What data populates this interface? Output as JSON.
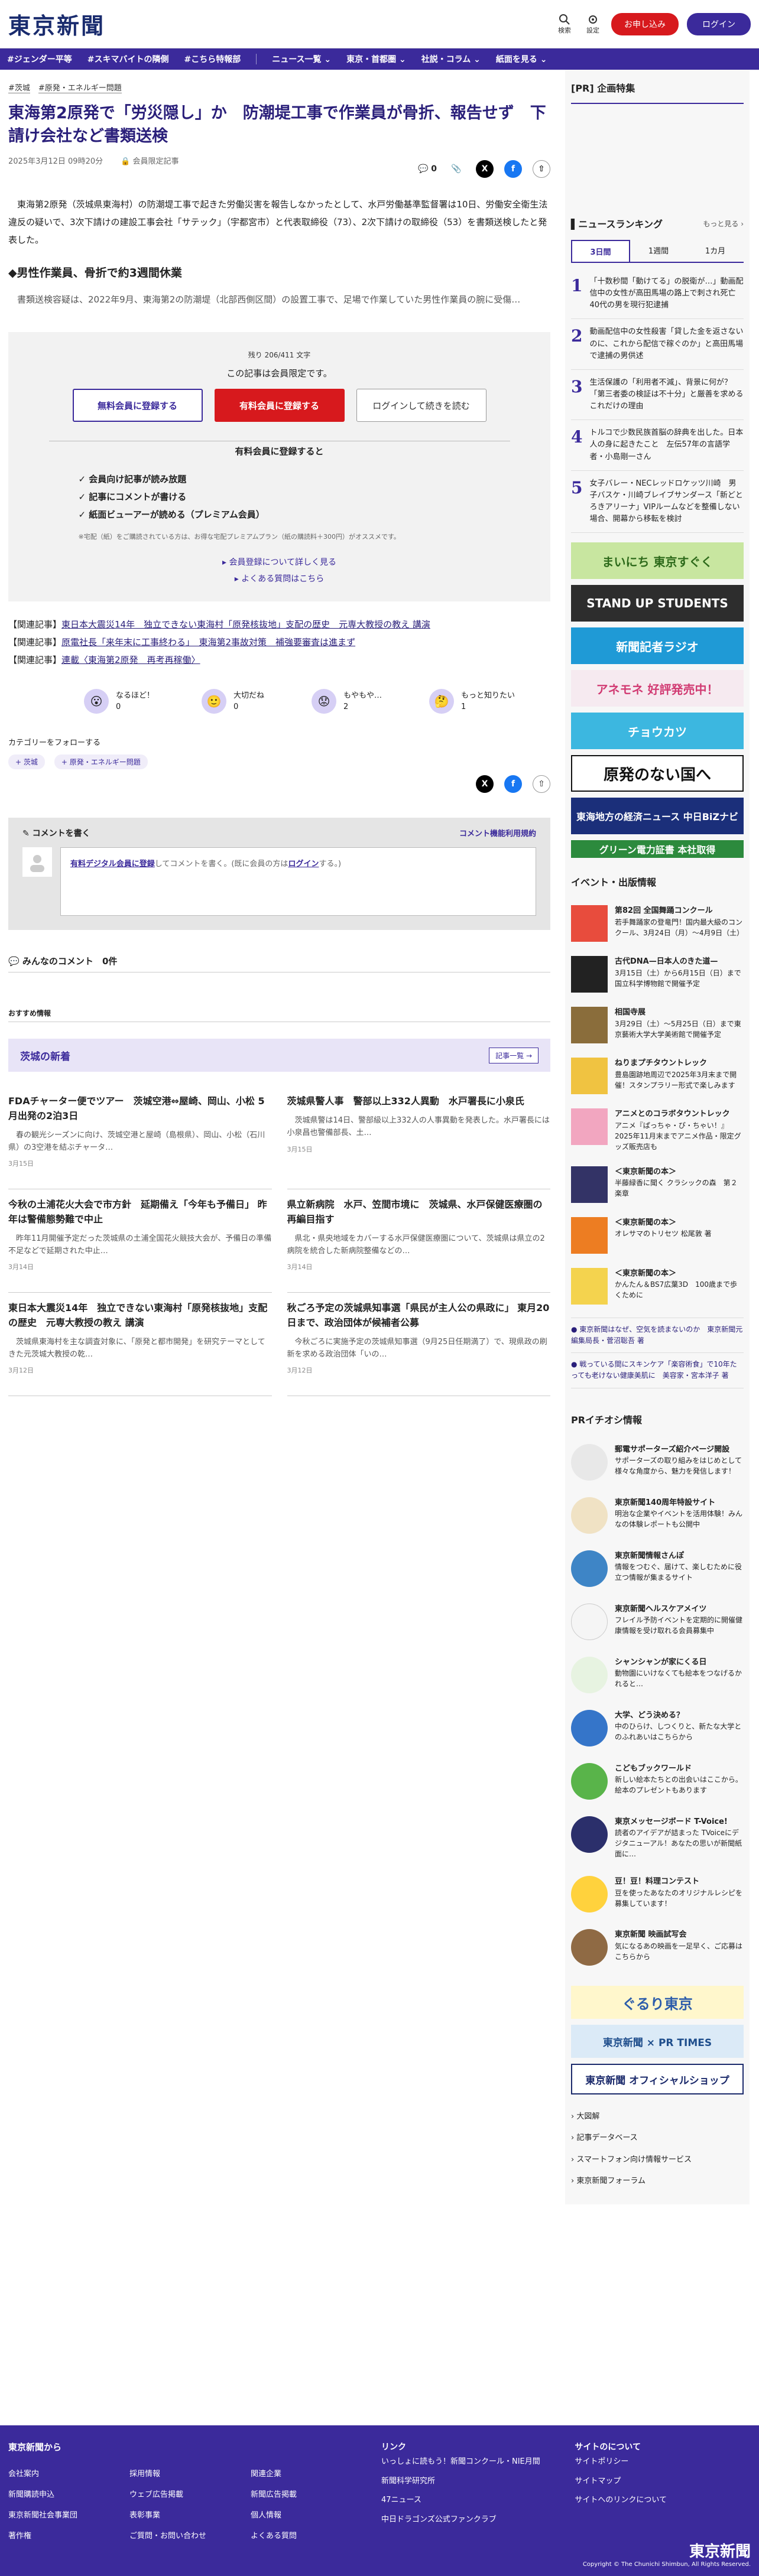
{
  "header": {
    "logo": "東京新聞",
    "search_label": "検索",
    "settings_label": "設定",
    "signup": "お申し込み",
    "login": "ログイン"
  },
  "nav": [
    "#ジェンダー平等",
    "#スキマバイトの隣側",
    "#こちら特報部",
    "ニュース一覧 ⌄",
    "東京・首都圏 ⌄",
    "社説・コラム ⌄",
    "紙面を見る ⌄"
  ],
  "article": {
    "tags": [
      "#茨城",
      "#原発・エネルギー問題"
    ],
    "title": "東海第2原発で「労災隠し」か　防潮堤工事で作業員が骨折、報告せず　下請け会社など書類送検",
    "date": "2025年3月12日 09時20分",
    "limited": "会員限定記事",
    "comment_count": "0",
    "lead": "　東海第2原発（茨城県東海村）の防潮堤工事で起きた労働災害を報告しなかったとして、水戸労働基準監督署は10日、労働安全衛生法違反の疑いで、3次下請けの建設工事会社「サテック」（宇都宮市）と代表取締役（73）、2次下請けの取締役（53）を書類送検したと発表した。",
    "subhead": "◆男性作業員、骨折で約3週間休業",
    "faded": "　書類送検容疑は、2022年9月、東海第2の防潮堤（北部西側区間）の設置工事で、足場で作業していた男性作業員の腕に受傷…"
  },
  "paywall": {
    "remaining": "残り 206/411 文字",
    "limited_text": "この記事は会員限定です。",
    "btn_free": "無料会員に登録する",
    "btn_paid": "有料会員に登録する",
    "btn_login": "ログインして続きを読む",
    "benefit_heading": "有料会員に登録すると",
    "benefits": [
      "✓ 会員向け記事が読み放題",
      "✓ 記事にコメントが書ける",
      "✓ 紙面ビューアーが読める（プレミアム会員）"
    ],
    "note": "※宅配（紙）をご購読されている方は、お得な宅配プレミアムプラン（紙の購読料＋300円）がオススメです。",
    "more1": "▸ 会員登録について詳しく見る",
    "more2": "▸ よくある質問はこちら"
  },
  "related": [
    {
      "prefix": "【関連記事】",
      "text": "東日本大震災14年　独立できない東海村「原発核抜地」支配の歴史　元専大教授の教え  講演"
    },
    {
      "prefix": "【関連記事】",
      "text": "原電社長「来年末に工事終わる」　東海第2事故対策　補強要審査は進まず"
    },
    {
      "prefix": "【関連記事】",
      "text": "連載〈東海第2原発　再考再稼働〉"
    }
  ],
  "reactions": [
    {
      "face": "😮",
      "label": "なるほど！",
      "count": "0"
    },
    {
      "face": "🙂",
      "label": "大切だね",
      "count": "0"
    },
    {
      "face": "😟",
      "label": "もやもや…",
      "count": "2"
    },
    {
      "face": "🤔",
      "label": "もっと知りたい",
      "count": "1"
    }
  ],
  "follow": {
    "label": "カテゴリーをフォローする",
    "chips": [
      "+ 茨城",
      "+ 原発・エネルギー問題"
    ]
  },
  "comment": {
    "title": "コメントを書く",
    "rules": "コメント機能利用規約",
    "link": "有料デジタル会員に登録",
    "text1": "してコメントを書く。(既に会員の方は",
    "login": "ログイン",
    "text2": "する。)",
    "all_label": "みんなのコメント",
    "all_count": "0件"
  },
  "recommend": {
    "label": "おすすめ情報",
    "section_title": "茨城の新着",
    "more": "記事一覧 →",
    "cards": [
      {
        "title": "FDAチャーター便でツアー　茨城空港⇔屋崎、岡山、小松 5月出発の2泊3日",
        "summary": "　春の観光シーズンに向け、茨城空港と屋崎（島根県）、岡山、小松（石川県）の3空港を結ぶチャータ…",
        "date": "3月15日"
      },
      {
        "title": "茨城県警人事　警部以上332人異動　水戸署長に小泉氏",
        "summary": "　茨城県警は14日、警部級以上332人の人事異動を発表した。水戸署長には小泉昌也警備部長、土…",
        "date": "3月15日"
      },
      {
        "title": "今秋の土浦花火大会で市方針　延期備え「今年も予備日」 昨年は警備態勢難で中止",
        "summary": "　昨年11月開催予定だった茨城県の土浦全国花火競技大会が、予備日の準備不足などで延期された中止…",
        "date": "3月14日"
      },
      {
        "title": "県立新病院　水戸、笠間市境に　茨城県、水戸保健医療圏の再編目指す",
        "summary": "　県北・県央地域をカバーする水戸保健医療圏について、茨城県は県立の2病院を統合した新病院整備などの…",
        "date": "3月14日"
      },
      {
        "title": "東日本大震災14年　独立できない東海村「原発核抜地」支配の歴史　元専大教授の教え  講演",
        "summary": "　茨城県東海村を主な調査対象に、「原発と都市開発」を研究テーマとしてきた元茨城大教授の乾…",
        "date": "3月12日"
      },
      {
        "title": "秋ごろ予定の茨城県知事選「県民が主人公の県政に」 東月20日まで、政治団体が候補者公募",
        "summary": "　今秋ごろに実施予定の茨城県知事選（9月25日任期満了）で、現県政の刷新を求める政治団体「いの…",
        "date": "3月12日"
      }
    ]
  },
  "sidebar": {
    "pr_title": "[PR] 企画特集",
    "ranking_title": "ニュースランキング",
    "ranking_more": "もっと見る ›",
    "tabs": [
      "3日間",
      "1週間",
      "1カ月"
    ],
    "ranks": [
      "「十数秒間「動けてる」の脱衛が…」動画配信中の女性が高田馬場の路上で刺され死亡 40代の男を現行犯逮捕",
      "動画配信中の女性殺害「貸した金を返さないのに、これから配信で稼ぐのか」と高田馬場で逮捕の男供述",
      "生活保護の「利用者不減」、背景に何が？「第三者委の検証は不十分」と厳善を求めるこれだけの理由",
      "トルコで少数民族首脳の辞典を出した。日本人の身に起きたこと　左伝57年の言語学者・小島剛一さん",
      "女子バレー・NECレッドロケッツ川崎　男子バスケ・川崎ブレイブサンダース「新どとろきアリーナ」VIPルームなどを整備しない場合、開幕から移転を検討"
    ],
    "banners": [
      {
        "text": "まいにち 東京すぐく",
        "bg": "#c8e6a0",
        "fg": "#2d6a1a"
      },
      {
        "text": "STAND UP STUDENTS",
        "bg": "#2d2d2d",
        "fg": "#ffffff"
      },
      {
        "text": "新聞記者ラジオ",
        "bg": "#1f9ad6",
        "fg": "#ffffff"
      },
      {
        "text": "アネモネ 好評発売中！",
        "bg": "#f6eaf0",
        "fg": "#d13a72"
      },
      {
        "text": "チョウカツ",
        "bg": "#3cb7e0",
        "fg": "#ffffff"
      },
      {
        "text": "原発のない国へ",
        "bg": "#ffffff",
        "fg": "#111111"
      },
      {
        "text": "東海地方の経済ニュース 中日BiZナビ",
        "bg": "#1b2f7a",
        "fg": "#ffffff"
      },
      {
        "text": "グリーン電力証書 本社取得",
        "bg": "#2c8a3d",
        "fg": "#ffffff"
      }
    ],
    "event_title": "イベント・出版情報",
    "events": [
      {
        "title": "第82回 全国舞踊コンクール",
        "desc": "若手舞踊家の登竜門！国内最大級のコンクール、3月24日（月）〜4月9日（土）",
        "color": "#e84c3d"
      },
      {
        "title": "古代DNA—日本人のきた道—",
        "desc": "3月15日（土）から6月15日（日）まで国立科学博物館で開催予定",
        "color": "#222222"
      },
      {
        "title": "相国寺展",
        "desc": "3月29日（土）〜5月25日（日）まで東京藝術大学大学美術館で開催予定",
        "color": "#8a6d3b"
      },
      {
        "title": "ねりまプチタウントレック",
        "desc": "豊島園跡地周辺で2025年3月末まで開催！スタンプラリー形式で楽しみます",
        "color": "#f0c341"
      },
      {
        "title": "アニメとのコラボタウントレック",
        "desc": "アニメ『ぱっちゃ・ぴ・ちゃい！』 2025年11月末までアニメ作品・限定グッズ販売店も",
        "color": "#f2a6c0"
      },
      {
        "title": "＜東京新聞の本＞",
        "desc": "半藤緑香に聞く クラシックの森　第２楽章",
        "color": "#333366"
      },
      {
        "title": "＜東京新聞の本＞",
        "desc": "オレサマのトリセツ\n松尾敦 著",
        "color": "#ed7d22"
      },
      {
        "title": "＜東京新聞の本＞",
        "desc": "かんたん＆BS7広葉3D　100歳まで歩くために",
        "color": "#f4d34e"
      }
    ],
    "sidelinks_a": [
      "● 東京新聞はなぜ、空気を読まないのか　東京新聞元編集局長・菅沼聡吾 著",
      "● 戦っている間にスキンケア「楽容術食」で10年たっても老けない健康美肌に　美容家・宮本洋子 著"
    ],
    "pr_title2": "PRイチオシ情報",
    "pr": [
      {
        "title": "郵電サポーターズ紹介ページ開設",
        "desc": "サポーターズの取り組みをはじめとして様々な角度から、魅力を発信します！",
        "color": "#e8e8e8"
      },
      {
        "title": "東京新聞140周年特設サイト",
        "desc": "明治な企業やイベントを活用体験！みんなの体験レポートも公開中",
        "color": "#f0e2c4"
      },
      {
        "title": "東京新聞情報さんぽ",
        "desc": "情報をつむぐ、届けて、楽しむために役立つ情報が集まるサイト",
        "color": "#3e85c6"
      },
      {
        "title": "東京新聞ヘルスケアメイツ",
        "desc": "フレイル予防イベントを定期的に開催健康情報を受け取れる会員募集中",
        "color": "#f5f5f5"
      },
      {
        "title": "シャンシャンが家にくる日",
        "desc": "動物園にいけなくても絵本をつなげるかれると…",
        "color": "#e7f3e1"
      },
      {
        "title": "大学、どう決める？",
        "desc": "中のひらけ、しつくりと、新たな大学とのふれあいはこちらから",
        "color": "#3575c9"
      },
      {
        "title": "こどもブックワールド",
        "desc": "新しい絵本たちとの出会いはここから。絵本のプレゼントもあります",
        "color": "#59b44a"
      },
      {
        "title": "東京メッセージボード T-Voice!",
        "desc": "読者のアイデアが詰まった TVoiceにデジタニューアル！あなたの思いが新聞紙面に…",
        "color": "#2b2f6b"
      },
      {
        "title": "豆！豆！料理コンテスト",
        "desc": "豆を使ったあなたのオリジナルレシピを募集しています！",
        "color": "#ffd23d"
      },
      {
        "title": "東京新聞 映画試写会",
        "desc": "気になるあの映画を一足早く、ご応募はこちらから",
        "color": "#8f6a44"
      }
    ],
    "banner_bottom": [
      {
        "text": "ぐるり東京",
        "bg": "#fff7cc",
        "fg": "#2d5dab"
      },
      {
        "text": "東京新聞 × PR TIMES",
        "bg": "#dbeaf7",
        "fg": "#1f4e8c"
      },
      {
        "text": "東京新聞 オフィシャルショップ",
        "bg": "#ffffff",
        "fg": "#1b2a6b"
      }
    ],
    "links": [
      "› 大図解",
      "› 記事データベース",
      "› スマートフォン向け情報サービス",
      "› 東京新聞フォーラム"
    ]
  },
  "footer": {
    "col1_title": "東京新聞から",
    "col1": [
      "会社案内",
      "採用情報",
      "関連企業",
      "新聞購読申込",
      "ウェブ広告掲載",
      "新聞広告掲載",
      "東京新聞社会事業団",
      "表彰事業",
      "個人情報",
      "著作権",
      "ご質問・お問い合わせ",
      "よくある質問"
    ],
    "col2_title": "リンク",
    "col2": [
      "いっしょに読もう！新聞コンクール・NIE月間",
      "新聞科学研究所",
      "47ニュース",
      "中日ドラゴンズ公式ファンクラブ"
    ],
    "col3_title": "サイトのについて",
    "col3": [
      "サイトポリシー",
      "サイトマップ",
      "サイトへのリンクについて"
    ],
    "logo": "東京新聞",
    "copyright": "Copyright © The Chunichi Shimbun, All Rights Reserved."
  }
}
